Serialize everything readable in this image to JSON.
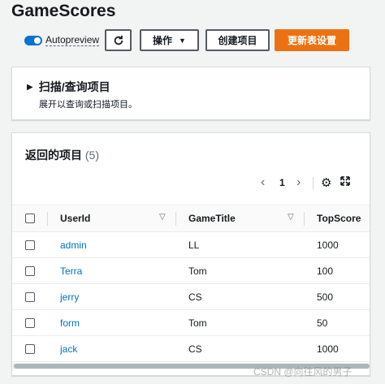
{
  "title": "GameScores",
  "toolbar": {
    "autopreview_label": "Autopreview",
    "autopreview_on": true,
    "actions_label": "操作",
    "create_label": "创建项目",
    "update_label": "更新表设置"
  },
  "scan": {
    "title": "扫描/查询项目",
    "description": "展开以查询或扫描项目。"
  },
  "results": {
    "title": "返回的项目",
    "count": "(5)",
    "page": "1",
    "columns": [
      "UserId",
      "GameTitle",
      "TopScore"
    ],
    "rows": [
      {
        "user": "admin",
        "game": "LL",
        "score": "1000"
      },
      {
        "user": "Terra",
        "game": "Tom",
        "score": "100"
      },
      {
        "user": "jerry",
        "game": "CS",
        "score": "500"
      },
      {
        "user": "form",
        "game": "Tom",
        "score": "50"
      },
      {
        "user": "jack",
        "game": "CS",
        "score": "1000"
      }
    ]
  },
  "icons": {
    "refresh": "refresh-icon",
    "caret": "caret-down-icon",
    "expand": "caret-right-icon",
    "prev": "chevron-left-icon",
    "next": "chevron-right-icon",
    "settings": "gear-icon",
    "fullscreen": "fullscreen-icon",
    "sort": "sort-icon"
  },
  "colors": {
    "primary": "#ec7211",
    "link": "#0073bb",
    "toggle": "#0972d3"
  },
  "watermark": "CSDN @向往风的男子"
}
